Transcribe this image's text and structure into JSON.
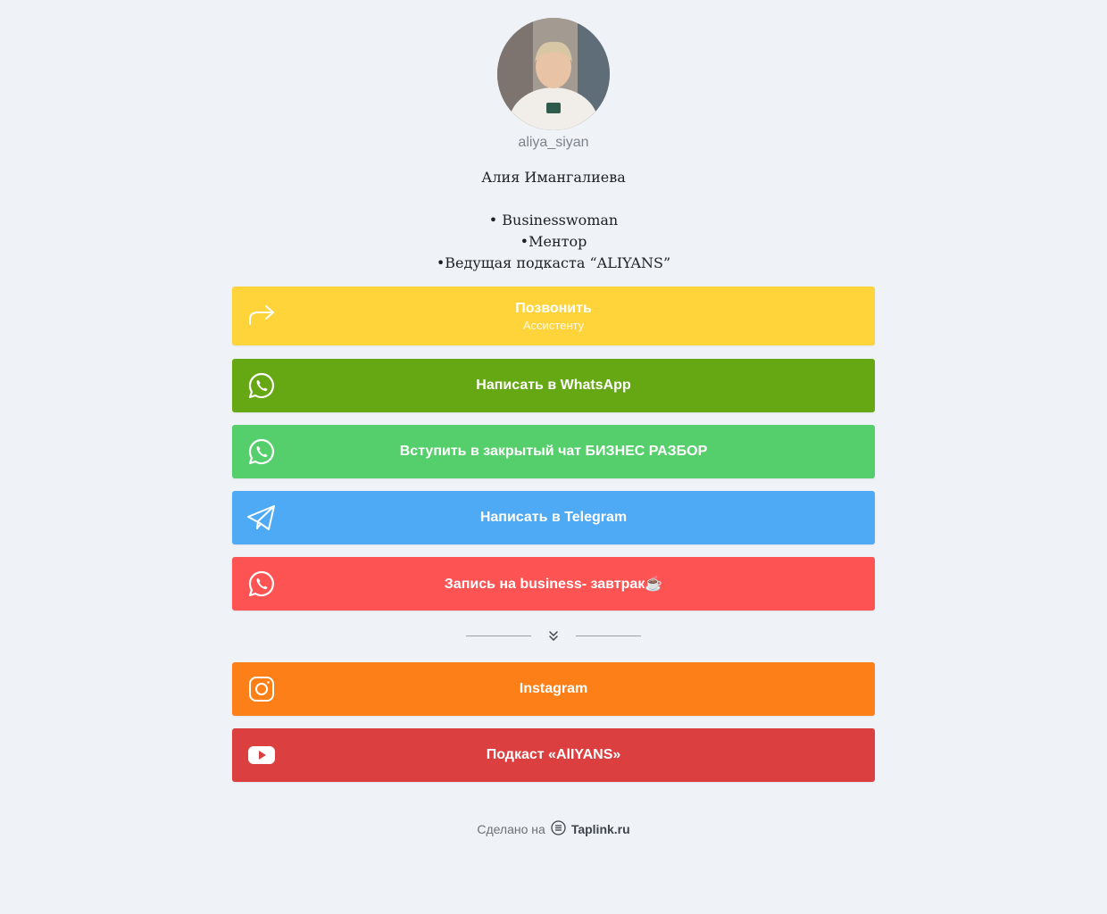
{
  "profile": {
    "username": "aliya_siyan",
    "name": "Алия Имангалиева",
    "bio_lines": [
      "• Businesswoman",
      "•Ментор",
      "•Ведущая подкаста “ALIYANS”"
    ]
  },
  "buttons": [
    {
      "label": "Позвонить",
      "sublabel": "Ассистенту",
      "icon": "share-arrow-icon",
      "color": "#ffd43b"
    },
    {
      "label": "Написать в WhatsApp",
      "icon": "whatsapp-icon",
      "color": "#66a813"
    },
    {
      "label": "Вступить в закрытый чат БИЗНЕС РАЗБОР",
      "icon": "whatsapp-icon",
      "color": "#55cf6b"
    },
    {
      "label": "Написать в Telegram",
      "icon": "telegram-icon",
      "color": "#4faaf5"
    },
    {
      "label": "Запись на business- завтрак☕",
      "icon": "whatsapp-icon",
      "color": "#fe5353"
    }
  ],
  "social_buttons": [
    {
      "label": "Instagram",
      "icon": "instagram-icon",
      "color": "#fd7f17"
    },
    {
      "label": "Подкаст «AlIYANS»",
      "icon": "youtube-icon",
      "color": "#db3f3f"
    }
  ],
  "footer": {
    "prefix": "Сделано на",
    "brand": "Taplink.ru"
  }
}
